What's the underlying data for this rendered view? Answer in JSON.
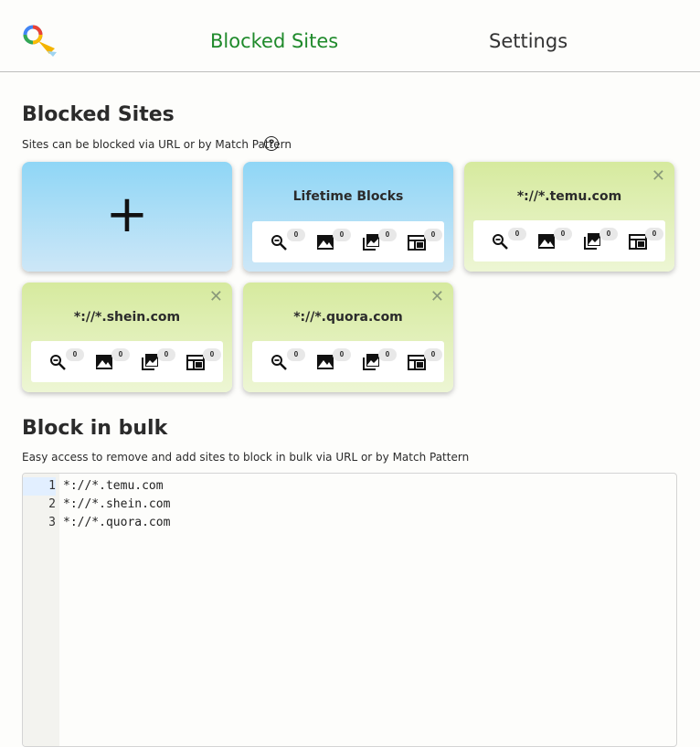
{
  "nav": {
    "active_tab": "Blocked Sites",
    "settings_tab": "Settings"
  },
  "blocked_sites": {
    "heading": "Blocked Sites",
    "subtitle": "Sites can be blocked via URL or by Match Pattern",
    "help_glyph": "?",
    "add_glyph": "+",
    "cards": [
      {
        "title": "Lifetime Blocks",
        "closable": false,
        "counts": [
          "0",
          "0",
          "0",
          "0"
        ]
      },
      {
        "title": "*://*.temu.com",
        "closable": true,
        "counts": [
          "0",
          "0",
          "0",
          "0"
        ]
      },
      {
        "title": "*://*.shein.com",
        "closable": true,
        "counts": [
          "0",
          "0",
          "0",
          "0"
        ]
      },
      {
        "title": "*://*.quora.com",
        "closable": true,
        "counts": [
          "0",
          "0",
          "0",
          "0"
        ]
      }
    ],
    "stat_icons": [
      "search-blocked-icon",
      "image-blocked-icon",
      "image-library-icon",
      "video-frame-icon"
    ],
    "close_glyph": "✕"
  },
  "bulk": {
    "heading": "Block in bulk",
    "subtitle": "Easy access to remove and add sites to block in bulk via URL or by Match Pattern",
    "lines": [
      {
        "num": "1",
        "text": "*://*.temu.com"
      },
      {
        "num": "2",
        "text": "*://*.shein.com"
      },
      {
        "num": "3",
        "text": "*://*.quora.com"
      }
    ]
  },
  "colors": {
    "accent": "#1f8a2b",
    "card_blue_top": "#8fd6f6",
    "card_green_top": "#d6ea9e"
  }
}
